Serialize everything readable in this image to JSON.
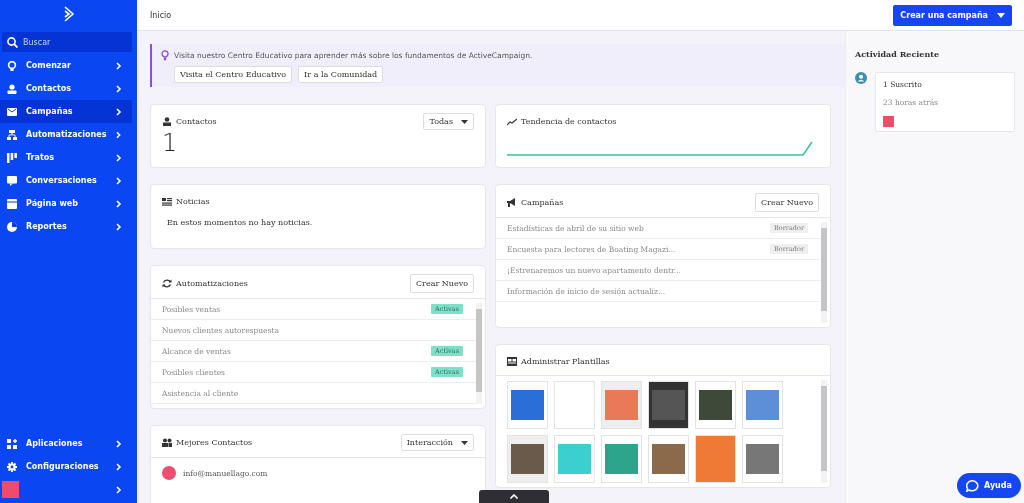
{
  "sidebar": {
    "search": {
      "placeholder": "Buscar"
    },
    "items": [
      {
        "label": "Comenzar",
        "selected": false
      },
      {
        "label": "Contactos",
        "selected": false
      },
      {
        "label": "Campañas",
        "selected": true
      },
      {
        "label": "Automatizaciones",
        "selected": false
      },
      {
        "label": "Tratos",
        "selected": false
      },
      {
        "label": "Conversaciones",
        "selected": false
      },
      {
        "label": "Página web",
        "selected": false
      },
      {
        "label": "Reportes",
        "selected": false
      }
    ],
    "bottom_items": [
      {
        "label": "Aplicaciones"
      },
      {
        "label": "Configuraciones"
      }
    ]
  },
  "header": {
    "breadcrumb": "Inicio",
    "create_button": "Crear una campaña"
  },
  "banner": {
    "text": "Visita nuestro Centro Educativo para aprender más sobre los fundamentos de ActiveCampaign.",
    "buttons": [
      "Visita el Centro Educativo",
      "Ir a la Comunidad"
    ]
  },
  "contacts": {
    "title": "Contactos",
    "filter": "Todas",
    "count": "1"
  },
  "trend": {
    "title": "Tendencia de contactos"
  },
  "news": {
    "title": "Noticias",
    "message": "En estos momentos no hay noticias."
  },
  "campaigns": {
    "title": "Campañas",
    "button": "Crear Nuevo",
    "rows": [
      {
        "name": "Estadísticas de abril de su sitio web",
        "status": "Borrador"
      },
      {
        "name": "Encuesta para lectores de Boating Magazi...",
        "status": "Borrador"
      },
      {
        "name": "¡Estrenaremos un nuevo apartamento dentr..."
      },
      {
        "name": "Información de inicio de sesión actualiz..."
      }
    ]
  },
  "automations": {
    "title": "Automatizaciones",
    "button": "Crear Nuevo",
    "rows": [
      {
        "name": "Posibles ventas",
        "status": "Activas"
      },
      {
        "name": "Nuevos clientes autorespuesta"
      },
      {
        "name": "Alcance de ventas",
        "status": "Activas"
      },
      {
        "name": "Posibles clientes",
        "status": "Activas"
      },
      {
        "name": "Asistencia al cliente"
      }
    ]
  },
  "templates": {
    "title": "Administrar Plantillas"
  },
  "top_contacts": {
    "title": "Mejores Contactos",
    "filter": "Interacción",
    "rows": [
      {
        "email": "info@manuellago.com"
      }
    ]
  },
  "activity": {
    "title": "Actividad Reciente",
    "items": [
      {
        "title": "1 Suscrito",
        "time": "23 horas atrás"
      }
    ]
  },
  "help_button": "Ayuda"
}
